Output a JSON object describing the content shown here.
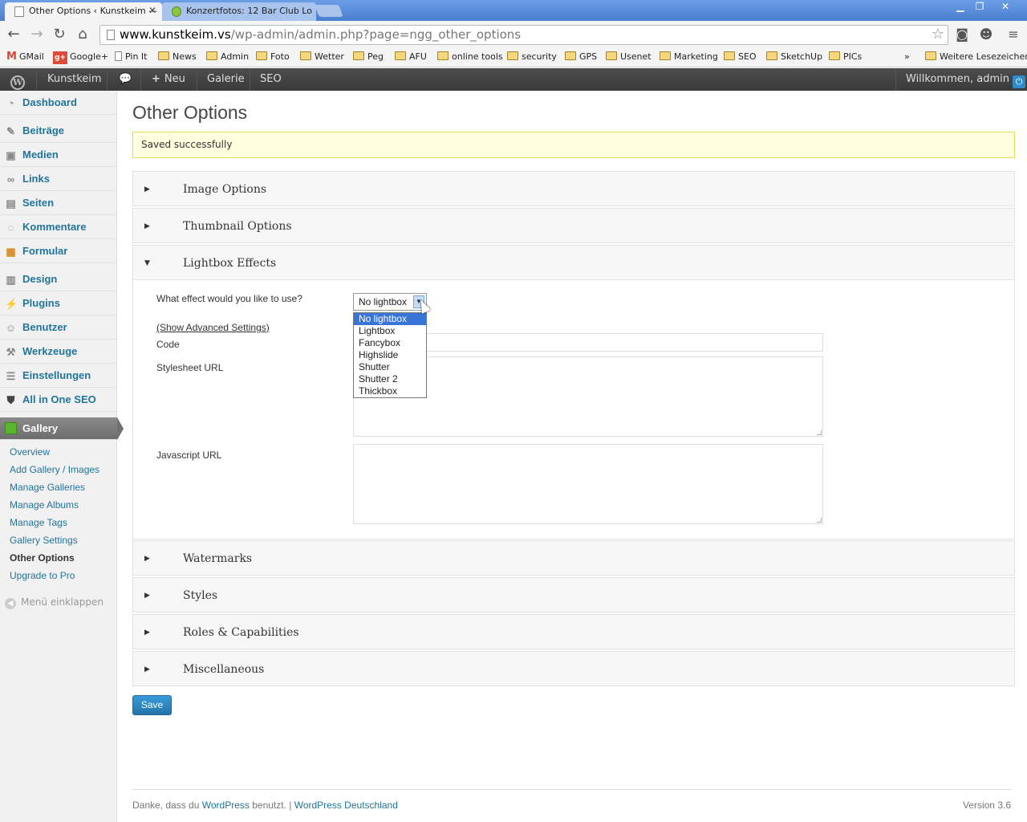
{
  "browser": {
    "tabs": [
      {
        "title": "Other Options ‹ Kunstkeim —",
        "close": "✕"
      },
      {
        "title": "Konzertfotos: 12 Bar Club Lo"
      }
    ],
    "url_domain": "www.kunstkeim.vs",
    "url_path": "/wp-admin/admin.php?page=ngg_other_options",
    "bookmarks": [
      "GMail",
      "Google+",
      "Pin It",
      "News",
      "Admin",
      "Foto",
      "Wetter",
      "Peg",
      "AFU",
      "online tools",
      "security",
      "GPS",
      "Usenet",
      "Marketing",
      "SEO",
      "SketchUp",
      "PICs"
    ],
    "bookmarks_more": "»",
    "bookmarks_other": "Weitere Lesezeichen"
  },
  "adminbar": {
    "site": "Kunstkeim",
    "new": "Neu",
    "galerie": "Galerie",
    "seo": "SEO",
    "welcome": "Willkommen, admin"
  },
  "sidebar": {
    "items": [
      {
        "label": "Dashboard",
        "icon": "dashboard-icon"
      },
      {
        "label": "Beiträge",
        "icon": "pin-icon"
      },
      {
        "label": "Medien",
        "icon": "media-icon"
      },
      {
        "label": "Links",
        "icon": "link-icon"
      },
      {
        "label": "Seiten",
        "icon": "page-icon"
      },
      {
        "label": "Kommentare",
        "icon": "comment-icon"
      },
      {
        "label": "Formular",
        "icon": "form-icon"
      },
      {
        "label": "Design",
        "icon": "design-icon"
      },
      {
        "label": "Plugins",
        "icon": "plugin-icon"
      },
      {
        "label": "Benutzer",
        "icon": "users-icon"
      },
      {
        "label": "Werkzeuge",
        "icon": "tools-icon"
      },
      {
        "label": "Einstellungen",
        "icon": "settings-icon"
      },
      {
        "label": "All in One SEO",
        "icon": "shield-icon"
      },
      {
        "label": "Gallery",
        "icon": "gallery-icon"
      }
    ],
    "submenu": [
      "Overview",
      "Add Gallery / Images",
      "Manage Galleries",
      "Manage Albums",
      "Manage Tags",
      "Gallery Settings",
      "Other Options",
      "Upgrade to Pro"
    ],
    "collapse": "Menü einklappen"
  },
  "main": {
    "title": "Other Options",
    "notice": "Saved successfully",
    "sections": [
      "Image Options",
      "Thumbnail Options",
      "Lightbox Effects",
      "Watermarks",
      "Styles",
      "Roles & Capabilities",
      "Miscellaneous"
    ],
    "lightbox": {
      "question": "What effect would you like to use?",
      "selected": "No lightbox",
      "options": [
        "No lightbox",
        "Lightbox",
        "Fancybox",
        "Highslide",
        "Shutter",
        "Shutter 2",
        "Thickbox"
      ],
      "advanced_link": "(Show Advanced Settings)",
      "code_label": "Code",
      "stylesheet_label": "Stylesheet URL",
      "javascript_label": "Javascript URL"
    },
    "save_label": "Save"
  },
  "footer": {
    "prefix": "Danke, dass du",
    "wordpress": "WordPress",
    "middle": "benutzt. |",
    "wp_de": "WordPress Deutschland",
    "version": "Version 3.6"
  },
  "colors": {
    "link": "#21759b",
    "admin_bar": "#464646",
    "accent_button": "#2e8ac9",
    "notice_bg": "#ffffe0"
  }
}
